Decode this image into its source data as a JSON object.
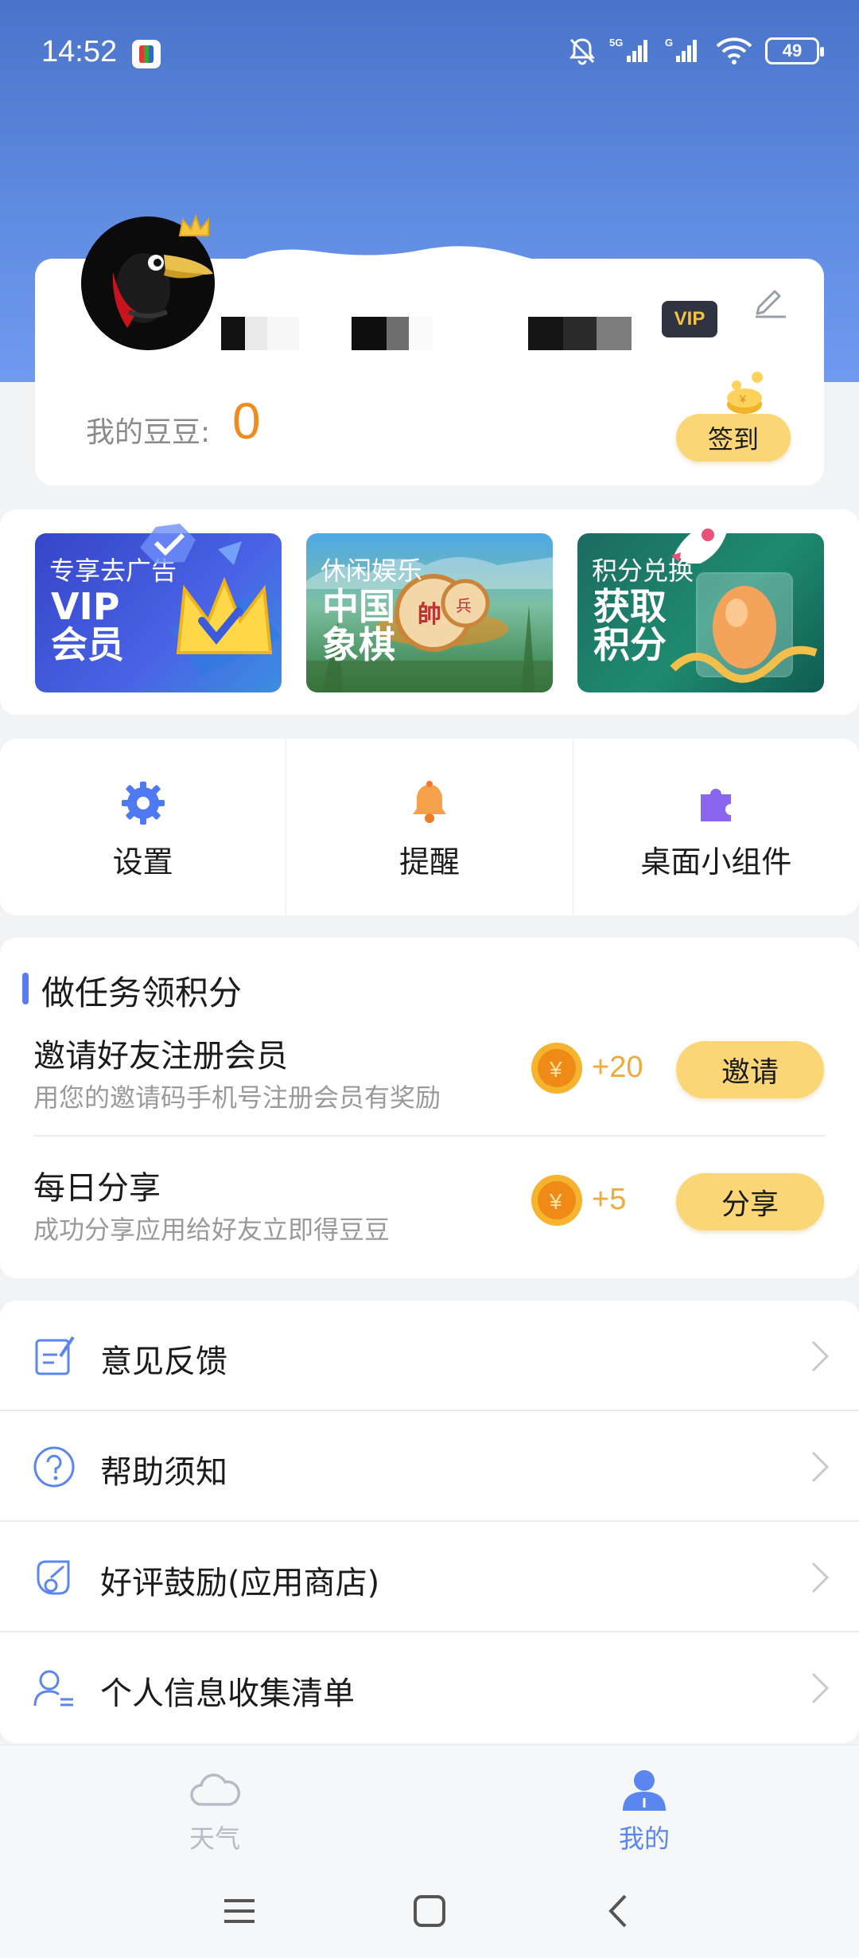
{
  "status_bar": {
    "time": "14:52",
    "network_1": "5G",
    "network_2": "G",
    "battery": "49"
  },
  "profile": {
    "vip_badge": "VIP",
    "beans_label": "我的豆豆:",
    "beans_value": "0",
    "signin_label": "签到"
  },
  "banners": [
    {
      "subtitle": "专享去广告",
      "title": "VIP 会员",
      "color": "#3f55dc"
    },
    {
      "subtitle": "休闲娱乐",
      "title": "中国 象棋",
      "color": "#5aa06a"
    },
    {
      "subtitle": "积分兑换",
      "title": "获取 积分",
      "color": "#1d7d68"
    }
  ],
  "shortcuts": [
    {
      "label": "设置",
      "icon": "gear-icon"
    },
    {
      "label": "提醒",
      "icon": "bell-icon"
    },
    {
      "label": "桌面小组件",
      "icon": "puzzle-icon"
    }
  ],
  "tasks": {
    "title": "做任务领积分",
    "items": [
      {
        "title": "邀请好友注册会员",
        "desc": "用您的邀请码手机号注册会员有奖励",
        "points": "+20",
        "button": "邀请"
      },
      {
        "title": "每日分享",
        "desc": "成功分享应用给好友立即得豆豆",
        "points": "+5",
        "button": "分享"
      }
    ]
  },
  "menu": [
    {
      "label": "意见反馈",
      "icon": "feedback-icon"
    },
    {
      "label": "帮助须知",
      "icon": "help-icon"
    },
    {
      "label": "好评鼓励(应用商店)",
      "icon": "rating-icon"
    },
    {
      "label": "个人信息收集清单",
      "icon": "personal-info-icon"
    }
  ],
  "bottom_nav": {
    "weather": "天气",
    "mine": "我的"
  },
  "colors": {
    "accent_yellow": "#fbd676",
    "beans_orange": "#f08b1e",
    "nav_active": "#5b86f0",
    "header_blue": "#4a74c9"
  }
}
